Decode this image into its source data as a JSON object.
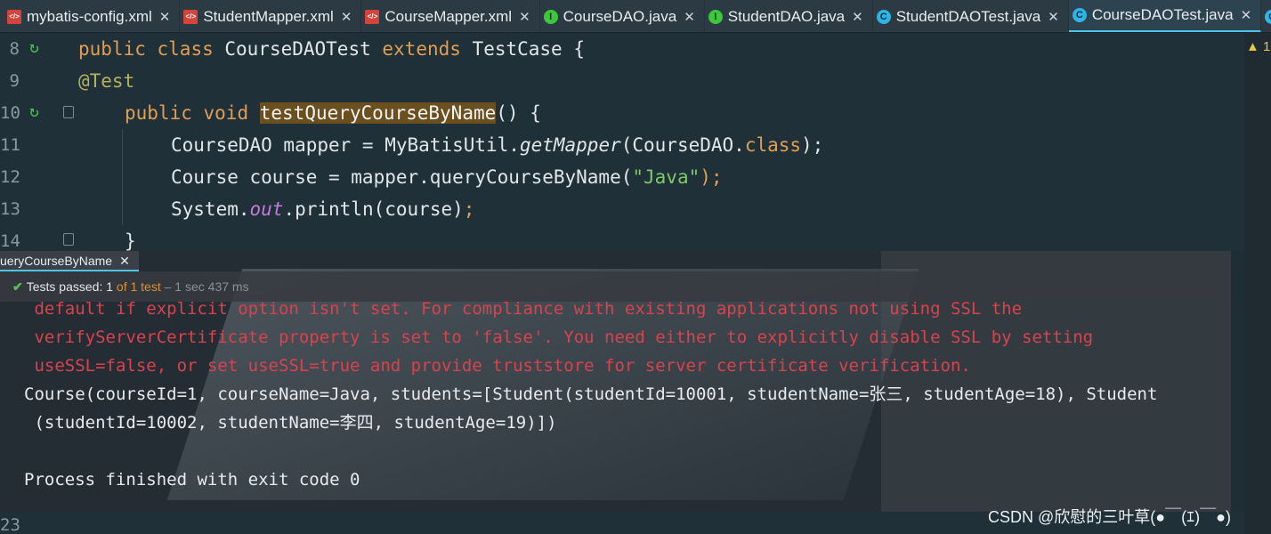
{
  "tabs": [
    {
      "label": "mybatis-config.xml",
      "icon": "xml-file-icon",
      "active": false
    },
    {
      "label": "StudentMapper.xml",
      "icon": "xml-file-icon",
      "active": false
    },
    {
      "label": "CourseMapper.xml",
      "icon": "xml-file-icon",
      "active": false
    },
    {
      "label": "CourseDAO.java",
      "icon": "interface-icon",
      "active": false
    },
    {
      "label": "StudentDAO.java",
      "icon": "interface-icon",
      "active": false
    },
    {
      "label": "StudentDAOTest.java",
      "icon": "class-icon",
      "active": false
    },
    {
      "label": "CourseDAOTest.java",
      "icon": "class-icon",
      "active": true
    }
  ],
  "warnings": {
    "count": "1"
  },
  "editor": {
    "line_numbers": [
      "8",
      "9",
      "10",
      "11",
      "12",
      "13",
      "14",
      "23"
    ],
    "lines": {
      "l8": {
        "kw1": "public",
        "kw2": "class",
        "name": " CourseDAOTest ",
        "kw3": "extends",
        "rest": " TestCase {"
      },
      "l9": {
        "ann": "@Test"
      },
      "l10": {
        "kw1": "public",
        "kw2": "void",
        "method": "testQueryCourseByName",
        "rest": "() {"
      },
      "l11": {
        "a": "CourseDAO mapper = MyBatisUtil.",
        "call": "getMapper",
        "b": "(CourseDAO.",
        "kw": "class",
        "c": ");"
      },
      "l12": {
        "a": "Course course = mapper.queryCourseByName(",
        "str": "\"Java\"",
        "c": ");"
      },
      "l13": {
        "a": "System.",
        "fld": "out",
        "b": ".println(course)",
        "c": ";"
      },
      "l14": {
        "a": "}"
      }
    }
  },
  "run": {
    "tab_label": "ueryCourseByName",
    "status": {
      "passed_label": "Tests passed:",
      "passed_count": "1",
      "of_label": "of 1 test",
      "duration": "– 1 sec 437 ms"
    },
    "output": [
      {
        "type": "err",
        "text": " default if explicit option isn't set. For compliance with existing applications not using SSL the"
      },
      {
        "type": "err",
        "text": " verifyServerCertificate property is set to 'false'. You need either to explicitly disable SSL by setting"
      },
      {
        "type": "err",
        "text": " useSSL=false, or set useSSL=true and provide truststore for server certificate verification."
      },
      {
        "type": "norm",
        "text": "Course(courseId=1, courseName=Java, students=[Student(studentId=10001, studentName=张三, studentAge=18), Student"
      },
      {
        "type": "norm",
        "text": " (studentId=10002, studentName=李四, studentAge=19)])"
      },
      {
        "type": "norm",
        "text": ""
      },
      {
        "type": "norm",
        "text": "Process finished with exit code 0"
      }
    ]
  },
  "watermark": "CSDN @欣慰的三叶草(●￣(ｴ)￣●)"
}
